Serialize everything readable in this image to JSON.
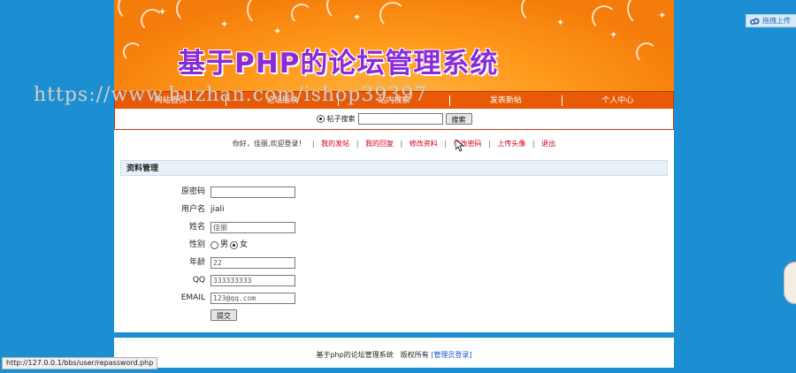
{
  "banner": {
    "title": "基于PHP的论坛管理系统"
  },
  "nav": {
    "items": [
      {
        "label": "网站首页"
      },
      {
        "label": "论坛版块"
      },
      {
        "label": "站内搜索"
      },
      {
        "label": "发表新帖"
      },
      {
        "label": "个人中心"
      }
    ]
  },
  "search": {
    "radio_label": "帖子搜索",
    "input_value": "",
    "button_label": "搜索"
  },
  "user_bar": {
    "greeting": "你好，佳丽,欢迎登录！",
    "sep": "|",
    "links": [
      "我的发帖",
      "我的回复",
      "修改资料",
      "修改密码",
      "上传头像",
      "退出"
    ]
  },
  "panel": {
    "title": "资料管理"
  },
  "form": {
    "old_password_label": "原密码",
    "old_password_value": "",
    "username_label": "用户名",
    "username_value": "jiali",
    "name_label": "姓名",
    "name_value": "佳丽",
    "gender_label": "性别",
    "gender_male": "男",
    "gender_female": "女",
    "gender_selected": "女",
    "age_label": "年龄",
    "age_value": "22",
    "qq_label": "QQ",
    "qq_value": "333333333",
    "email_label": "EMAIL",
    "email_value": "123@qq.com",
    "submit_label": "提交"
  },
  "footer": {
    "text": "基于php的论坛管理系统　版权所有",
    "admin_link": "[管理员登录]"
  },
  "watermark": {
    "text": "https://www.huzhan.com/ishop39397"
  },
  "status_bar": {
    "url": "http://127.0.0.1/bbs/user/repassword.php"
  },
  "upload_widget": {
    "label": "拖拽上传"
  },
  "colors": {
    "background": "#1b8fd1",
    "nav": "#e95a06",
    "banner": "#ff9a1c",
    "link_red": "#d0021b",
    "link_blue": "#1a55c4",
    "title_purple": "#8a2bd8"
  }
}
